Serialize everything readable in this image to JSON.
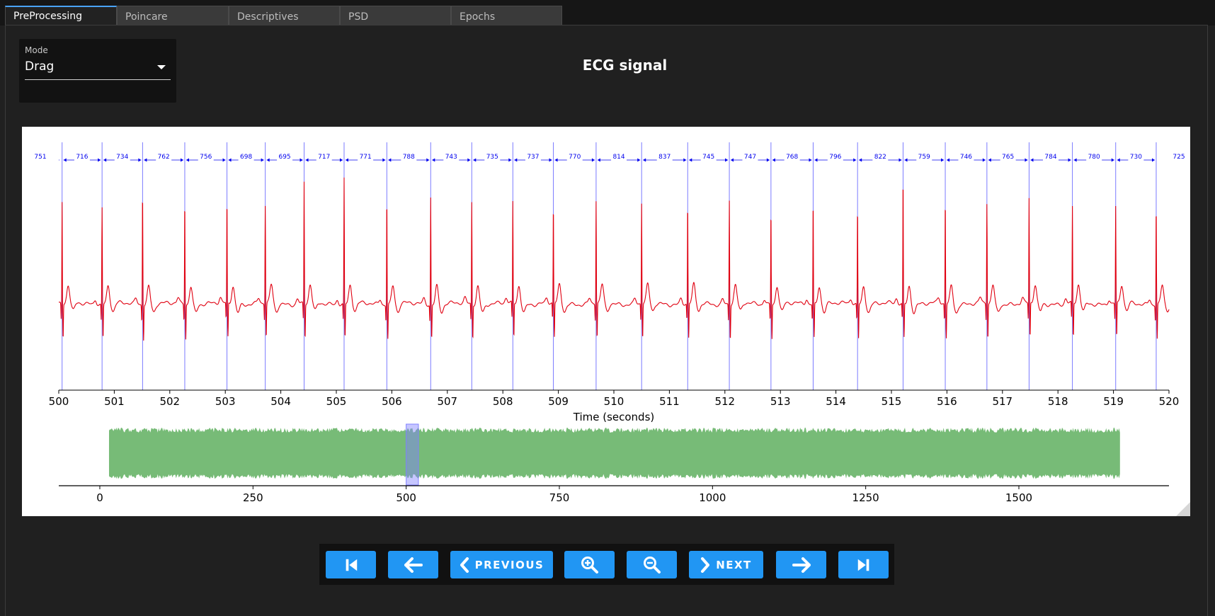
{
  "tabs": [
    {
      "label": "PreProcessing",
      "active": true
    },
    {
      "label": "Poincare",
      "active": false
    },
    {
      "label": "Descriptives",
      "active": false
    },
    {
      "label": "PSD",
      "active": false
    },
    {
      "label": "Epochs",
      "active": false
    }
  ],
  "mode": {
    "label": "Mode",
    "value": "Drag"
  },
  "title": "ECG signal",
  "chart_data": [
    {
      "type": "line",
      "title": "ECG signal",
      "xlabel": "Time (seconds)",
      "ylabel": "",
      "xlim": [
        500,
        520
      ],
      "x_ticks": [
        500,
        501,
        502,
        503,
        504,
        505,
        506,
        507,
        508,
        509,
        510,
        511,
        512,
        513,
        514,
        515,
        516,
        517,
        518,
        519,
        520
      ],
      "series_color": "#e00010",
      "r_peaks_s": [
        500.06,
        500.78,
        501.51,
        502.27,
        503.03,
        503.72,
        504.42,
        505.14,
        505.91,
        506.7,
        507.44,
        508.18,
        508.91,
        509.68,
        510.5,
        511.33,
        512.08,
        512.83,
        513.59,
        514.39,
        515.21,
        515.97,
        516.72,
        517.48,
        518.26,
        519.04,
        519.77
      ],
      "rr_intervals_ms": [
        751,
        716,
        734,
        762,
        756,
        698,
        695,
        717,
        771,
        788,
        743,
        735,
        737,
        770,
        814,
        837,
        745,
        747,
        768,
        796,
        822,
        759,
        746,
        765,
        784,
        780,
        730,
        725
      ],
      "annotation_color": "#0000ee",
      "peak_line_color": "#7b7bff"
    },
    {
      "type": "area",
      "title": "",
      "xlabel": "",
      "x_ticks": [
        0,
        250,
        500,
        750,
        1000,
        1250,
        1500
      ],
      "xlim": [
        -67,
        1745
      ],
      "data_range": [
        15,
        1665
      ],
      "selection": [
        500,
        520
      ],
      "series_color": "#77bb77",
      "selection_color": "#8080ff"
    }
  ],
  "buttons": {
    "first_icon": "skip-first-icon",
    "back_icon": "arrow-left-icon",
    "previous_label": "PREVIOUS",
    "zoom_in_icon": "zoom-in-icon",
    "zoom_out_icon": "zoom-out-icon",
    "next_label": "NEXT",
    "forward_icon": "arrow-right-icon",
    "last_icon": "skip-last-icon",
    "accent": "#2196f3"
  }
}
